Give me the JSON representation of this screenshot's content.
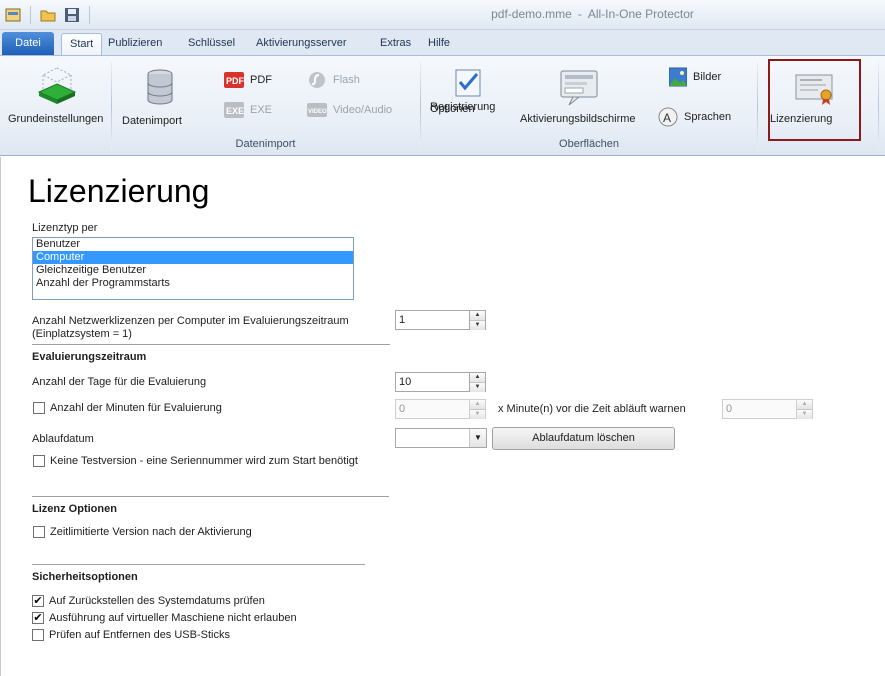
{
  "window": {
    "title_doc": "pdf-demo.mme",
    "title_sep": "-",
    "title_app": "All-In-One Protector"
  },
  "tabs": {
    "file": "Datei",
    "items": [
      "Start",
      "Publizieren",
      "Schlüssel",
      "Aktivierungsserver",
      "Extras",
      "Hilfe"
    ]
  },
  "ribbon": {
    "grundeinstellungen": "Grundeinstellungen",
    "datenimport": "Datenimport",
    "pdf": "PDF",
    "exe": "EXE",
    "flash": "Flash",
    "video_audio": "Video/Audio",
    "group_datenimport": "Datenimport",
    "optionen_line1": "Optionen",
    "optionen_line2": "Registrierung",
    "aktivierungsbildschirme": "Aktivierungsbildschirme",
    "bilder": "Bilder",
    "sprachen": "Sprachen",
    "group_oberflaechen": "Oberflächen",
    "lizenzierung": "Lizenzierung"
  },
  "page": {
    "title": "Lizenzierung",
    "lizenztyp_label": "Lizenztyp per",
    "lizenztyp_options": [
      "Benutzer",
      "Computer",
      "Gleichzeitige Benutzer",
      "Anzahl der Programmstarts"
    ],
    "lizenztyp_selected": "Computer",
    "netzwerk_label_line1": "Anzahl Netzwerklizenzen per Computer im Evaluierungszeitraum",
    "netzwerk_label_line2": "(Einplatzsystem = 1)",
    "netzwerk_value": "1",
    "section_evaluierung": "Evaluierungszeitraum",
    "tage_label": "Anzahl der Tage für die Evaluierung",
    "tage_value": "10",
    "minuten_label": "Anzahl der Minuten für Evaluierung",
    "minuten_value": "0",
    "warnen_label": "x Minute(n) vor die Zeit abläuft warnen",
    "warnen_value": "0",
    "ablaufdatum_label": "Ablaufdatum",
    "ablaufdatum_value": "",
    "ablaufdatum_button": "Ablaufdatum löschen",
    "keine_test_label": "Keine Testversion - eine Seriennummer wird zum Start benötigt",
    "section_lizenz_optionen": "Lizenz Optionen",
    "zeitlimit_label": "Zeitlimitierte Version nach der Aktivierung",
    "section_sicherheit": "Sicherheitsoptionen",
    "sicher_opt1": "Auf Zurückstellen des Systemdatums prüfen",
    "sicher_opt2": "Ausführung auf virtueller Maschiene nicht erlauben",
    "sicher_opt3": "Prüfen auf Entfernen des USB-Sticks",
    "sicher_opt1_checked": true,
    "sicher_opt2_checked": true,
    "sicher_opt3_checked": false
  }
}
